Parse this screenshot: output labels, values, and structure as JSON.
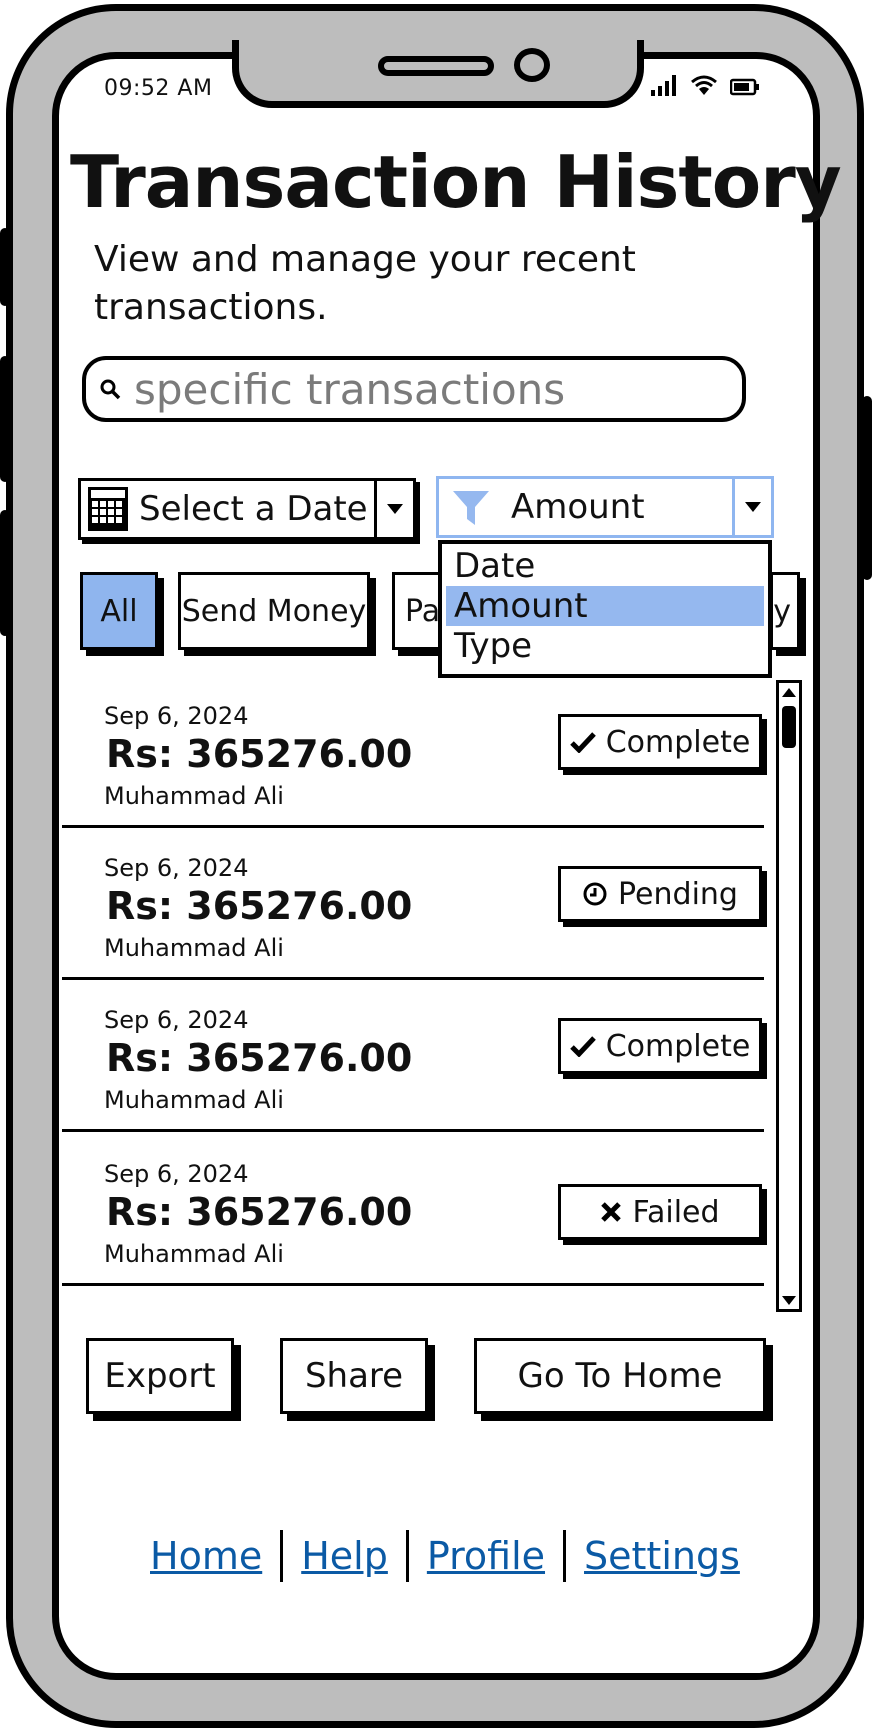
{
  "status_bar": {
    "time": "09:52 AM"
  },
  "header": {
    "title": "Transaction History",
    "subtitle": "View and manage your recent transactions."
  },
  "search": {
    "placeholder": "specific transactions"
  },
  "filters": {
    "date_select_label": "Select a Date",
    "sort_select_label": "Amount",
    "sort_options": [
      "Date",
      "Amount",
      "Type"
    ],
    "sort_selected": "Amount"
  },
  "chips": {
    "all": "All",
    "send_money": "Send Money",
    "payments_partial": "Pa",
    "other_partial": "y"
  },
  "transactions": [
    {
      "date": "Sep 6, 2024",
      "amount": "Rs: 365276.00",
      "name": "Muhammad Ali",
      "status": "Complete",
      "status_icon": "check-icon"
    },
    {
      "date": "Sep 6, 2024",
      "amount": "Rs: 365276.00",
      "name": "Muhammad Ali",
      "status": "Pending",
      "status_icon": "clock-icon"
    },
    {
      "date": "Sep 6, 2024",
      "amount": "Rs: 365276.00",
      "name": "Muhammad Ali",
      "status": "Complete",
      "status_icon": "check-icon"
    },
    {
      "date": "Sep 6, 2024",
      "amount": "Rs: 365276.00",
      "name": "Muhammad Ali",
      "status": "Failed",
      "status_icon": "x-icon"
    }
  ],
  "actions": {
    "export": "Export",
    "share": "Share",
    "go_home": "Go To Home"
  },
  "footer": {
    "home": "Home",
    "help": "Help",
    "profile": "Profile",
    "settings": "Settings"
  },
  "colors": {
    "accent": "#95b8ef",
    "link": "#0b5aa5",
    "frame": "#bdbdbd"
  }
}
